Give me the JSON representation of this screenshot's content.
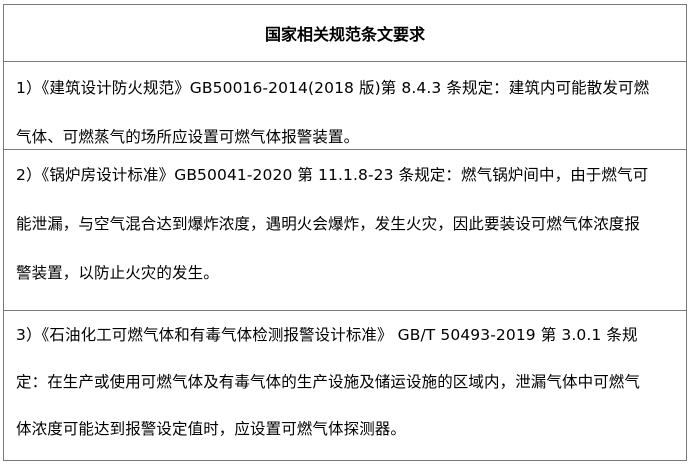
{
  "table": {
    "header": "国家相关规范条文要求",
    "rows": [
      {
        "lines": [
          "1）《建筑设计防火规范》GB50016-2014(2018 版)第 8.4.3 条规定：建筑内可能散发可燃",
          "气体、可燃蒸气的场所应设置可燃气体报警装置。"
        ]
      },
      {
        "lines": [
          "2）《锅炉房设计标准》GB50041-2020 第 11.1.8-23 条规定：燃气锅炉间中，由于燃气可",
          "能泄漏，与空气混合达到爆炸浓度，遇明火会爆炸，发生火灾，因此要装设可燃气体浓度报",
          "警装置，以防止火灾的发生。"
        ]
      },
      {
        "lines": [
          "3）《石油化工可燃气体和有毒气体检测报警设计标准》 GB/T 50493-2019 第 3.0.1 条规",
          "定：在生产或使用可燃气体及有毒气体的生产设施及储运设施的区域内，泄漏气体中可燃气",
          "体浓度可能达到报警设定值时，应设置可燃气体探测器。"
        ]
      }
    ]
  }
}
